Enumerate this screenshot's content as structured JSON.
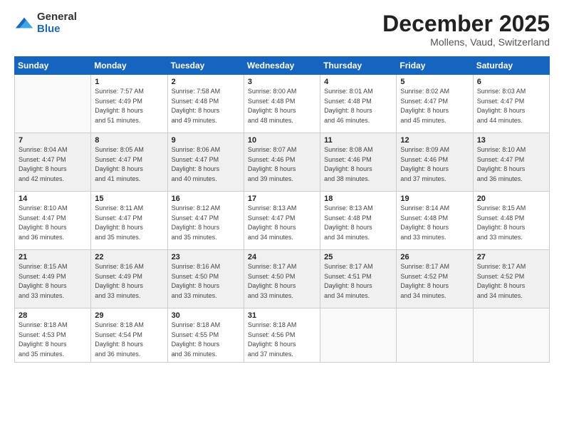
{
  "logo": {
    "general": "General",
    "blue": "Blue"
  },
  "title": "December 2025",
  "location": "Mollens, Vaud, Switzerland",
  "weekdays": [
    "Sunday",
    "Monday",
    "Tuesday",
    "Wednesday",
    "Thursday",
    "Friday",
    "Saturday"
  ],
  "weeks": [
    [
      {
        "day": null,
        "sunrise": null,
        "sunset": null,
        "daylight": null
      },
      {
        "day": "1",
        "sunrise": "Sunrise: 7:57 AM",
        "sunset": "Sunset: 4:49 PM",
        "daylight": "Daylight: 8 hours and 51 minutes."
      },
      {
        "day": "2",
        "sunrise": "Sunrise: 7:58 AM",
        "sunset": "Sunset: 4:48 PM",
        "daylight": "Daylight: 8 hours and 49 minutes."
      },
      {
        "day": "3",
        "sunrise": "Sunrise: 8:00 AM",
        "sunset": "Sunset: 4:48 PM",
        "daylight": "Daylight: 8 hours and 48 minutes."
      },
      {
        "day": "4",
        "sunrise": "Sunrise: 8:01 AM",
        "sunset": "Sunset: 4:48 PM",
        "daylight": "Daylight: 8 hours and 46 minutes."
      },
      {
        "day": "5",
        "sunrise": "Sunrise: 8:02 AM",
        "sunset": "Sunset: 4:47 PM",
        "daylight": "Daylight: 8 hours and 45 minutes."
      },
      {
        "day": "6",
        "sunrise": "Sunrise: 8:03 AM",
        "sunset": "Sunset: 4:47 PM",
        "daylight": "Daylight: 8 hours and 44 minutes."
      }
    ],
    [
      {
        "day": "7",
        "sunrise": "Sunrise: 8:04 AM",
        "sunset": "Sunset: 4:47 PM",
        "daylight": "Daylight: 8 hours and 42 minutes."
      },
      {
        "day": "8",
        "sunrise": "Sunrise: 8:05 AM",
        "sunset": "Sunset: 4:47 PM",
        "daylight": "Daylight: 8 hours and 41 minutes."
      },
      {
        "day": "9",
        "sunrise": "Sunrise: 8:06 AM",
        "sunset": "Sunset: 4:47 PM",
        "daylight": "Daylight: 8 hours and 40 minutes."
      },
      {
        "day": "10",
        "sunrise": "Sunrise: 8:07 AM",
        "sunset": "Sunset: 4:46 PM",
        "daylight": "Daylight: 8 hours and 39 minutes."
      },
      {
        "day": "11",
        "sunrise": "Sunrise: 8:08 AM",
        "sunset": "Sunset: 4:46 PM",
        "daylight": "Daylight: 8 hours and 38 minutes."
      },
      {
        "day": "12",
        "sunrise": "Sunrise: 8:09 AM",
        "sunset": "Sunset: 4:46 PM",
        "daylight": "Daylight: 8 hours and 37 minutes."
      },
      {
        "day": "13",
        "sunrise": "Sunrise: 8:10 AM",
        "sunset": "Sunset: 4:47 PM",
        "daylight": "Daylight: 8 hours and 36 minutes."
      }
    ],
    [
      {
        "day": "14",
        "sunrise": "Sunrise: 8:10 AM",
        "sunset": "Sunset: 4:47 PM",
        "daylight": "Daylight: 8 hours and 36 minutes."
      },
      {
        "day": "15",
        "sunrise": "Sunrise: 8:11 AM",
        "sunset": "Sunset: 4:47 PM",
        "daylight": "Daylight: 8 hours and 35 minutes."
      },
      {
        "day": "16",
        "sunrise": "Sunrise: 8:12 AM",
        "sunset": "Sunset: 4:47 PM",
        "daylight": "Daylight: 8 hours and 35 minutes."
      },
      {
        "day": "17",
        "sunrise": "Sunrise: 8:13 AM",
        "sunset": "Sunset: 4:47 PM",
        "daylight": "Daylight: 8 hours and 34 minutes."
      },
      {
        "day": "18",
        "sunrise": "Sunrise: 8:13 AM",
        "sunset": "Sunset: 4:48 PM",
        "daylight": "Daylight: 8 hours and 34 minutes."
      },
      {
        "day": "19",
        "sunrise": "Sunrise: 8:14 AM",
        "sunset": "Sunset: 4:48 PM",
        "daylight": "Daylight: 8 hours and 33 minutes."
      },
      {
        "day": "20",
        "sunrise": "Sunrise: 8:15 AM",
        "sunset": "Sunset: 4:48 PM",
        "daylight": "Daylight: 8 hours and 33 minutes."
      }
    ],
    [
      {
        "day": "21",
        "sunrise": "Sunrise: 8:15 AM",
        "sunset": "Sunset: 4:49 PM",
        "daylight": "Daylight: 8 hours and 33 minutes."
      },
      {
        "day": "22",
        "sunrise": "Sunrise: 8:16 AM",
        "sunset": "Sunset: 4:49 PM",
        "daylight": "Daylight: 8 hours and 33 minutes."
      },
      {
        "day": "23",
        "sunrise": "Sunrise: 8:16 AM",
        "sunset": "Sunset: 4:50 PM",
        "daylight": "Daylight: 8 hours and 33 minutes."
      },
      {
        "day": "24",
        "sunrise": "Sunrise: 8:17 AM",
        "sunset": "Sunset: 4:50 PM",
        "daylight": "Daylight: 8 hours and 33 minutes."
      },
      {
        "day": "25",
        "sunrise": "Sunrise: 8:17 AM",
        "sunset": "Sunset: 4:51 PM",
        "daylight": "Daylight: 8 hours and 34 minutes."
      },
      {
        "day": "26",
        "sunrise": "Sunrise: 8:17 AM",
        "sunset": "Sunset: 4:52 PM",
        "daylight": "Daylight: 8 hours and 34 minutes."
      },
      {
        "day": "27",
        "sunrise": "Sunrise: 8:17 AM",
        "sunset": "Sunset: 4:52 PM",
        "daylight": "Daylight: 8 hours and 34 minutes."
      }
    ],
    [
      {
        "day": "28",
        "sunrise": "Sunrise: 8:18 AM",
        "sunset": "Sunset: 4:53 PM",
        "daylight": "Daylight: 8 hours and 35 minutes."
      },
      {
        "day": "29",
        "sunrise": "Sunrise: 8:18 AM",
        "sunset": "Sunset: 4:54 PM",
        "daylight": "Daylight: 8 hours and 36 minutes."
      },
      {
        "day": "30",
        "sunrise": "Sunrise: 8:18 AM",
        "sunset": "Sunset: 4:55 PM",
        "daylight": "Daylight: 8 hours and 36 minutes."
      },
      {
        "day": "31",
        "sunrise": "Sunrise: 8:18 AM",
        "sunset": "Sunset: 4:56 PM",
        "daylight": "Daylight: 8 hours and 37 minutes."
      },
      {
        "day": null,
        "sunrise": null,
        "sunset": null,
        "daylight": null
      },
      {
        "day": null,
        "sunrise": null,
        "sunset": null,
        "daylight": null
      },
      {
        "day": null,
        "sunrise": null,
        "sunset": null,
        "daylight": null
      }
    ]
  ]
}
